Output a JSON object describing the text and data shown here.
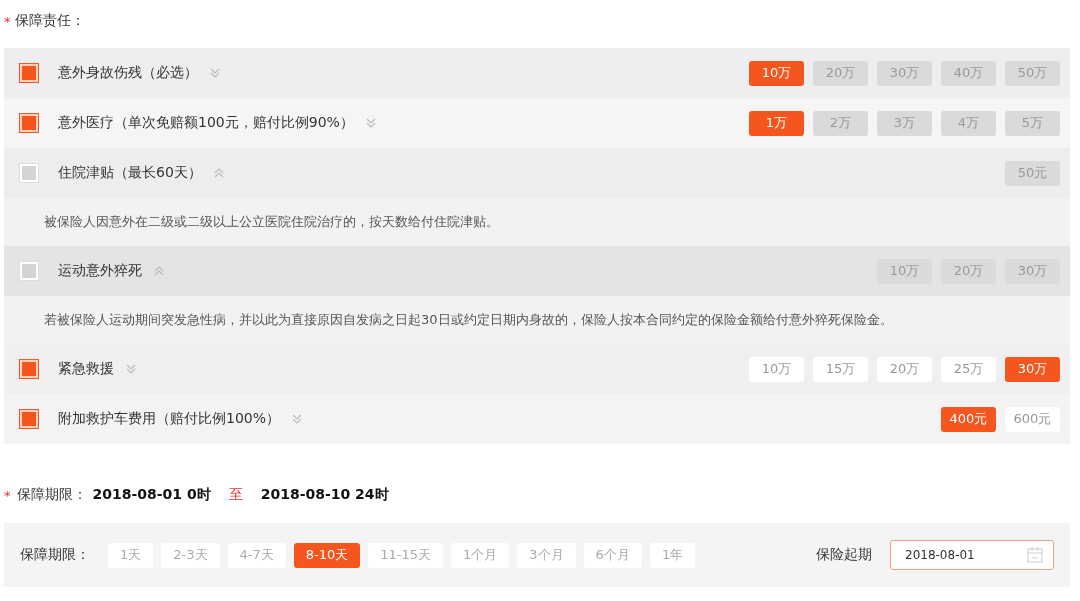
{
  "coverage": {
    "required_mark": "*",
    "label": "保障责任：",
    "items": [
      {
        "title": "意外身故伤残（必选）",
        "checked": true,
        "expanded": false,
        "options": [
          {
            "label": "10万",
            "selected": true
          },
          {
            "label": "20万",
            "selected": false
          },
          {
            "label": "30万",
            "selected": false
          },
          {
            "label": "40万",
            "selected": false
          },
          {
            "label": "50万",
            "selected": false
          }
        ]
      },
      {
        "title": "意外医疗（单次免赔额100元，赔付比例90%）",
        "checked": true,
        "expanded": false,
        "options": [
          {
            "label": "1万",
            "selected": true
          },
          {
            "label": "2万",
            "selected": false
          },
          {
            "label": "3万",
            "selected": false
          },
          {
            "label": "4万",
            "selected": false
          },
          {
            "label": "5万",
            "selected": false
          }
        ]
      },
      {
        "title": "住院津贴（最长60天）",
        "checked": false,
        "expanded": true,
        "description": "被保险人因意外在二级或二级以上公立医院住院治疗的，按天数给付住院津贴。",
        "options": [
          {
            "label": "50元",
            "selected": false
          }
        ]
      },
      {
        "title": "运动意外猝死",
        "checked": false,
        "expanded": true,
        "description": "若被保险人运动期间突发急性病，并以此为直接原因自发病之日起30日或约定日期内身故的，保险人按本合同约定的保险金额给付意外猝死保险金。",
        "options": [
          {
            "label": "10万",
            "selected": false
          },
          {
            "label": "20万",
            "selected": false
          },
          {
            "label": "30万",
            "selected": false
          }
        ]
      },
      {
        "title": "紧急救援",
        "checked": true,
        "expanded": false,
        "options": [
          {
            "label": "10万",
            "selected": false
          },
          {
            "label": "15万",
            "selected": false
          },
          {
            "label": "20万",
            "selected": false
          },
          {
            "label": "25万",
            "selected": false
          },
          {
            "label": "30万",
            "selected": true
          }
        ]
      },
      {
        "title": "附加救护车费用（赔付比例100%）",
        "checked": true,
        "expanded": false,
        "options": [
          {
            "label": "400元",
            "selected": true
          },
          {
            "label": "600元",
            "selected": false
          }
        ]
      }
    ]
  },
  "period": {
    "required_mark": "*",
    "label": "保障期限：",
    "start": "2018-08-01 0时",
    "separator": "至",
    "end": "2018-08-10 24时"
  },
  "duration": {
    "label": "保障期限：",
    "options": [
      {
        "label": "1天",
        "selected": false
      },
      {
        "label": "2-3天",
        "selected": false
      },
      {
        "label": "4-7天",
        "selected": false
      },
      {
        "label": "8-10天",
        "selected": true
      },
      {
        "label": "11-15天",
        "selected": false
      },
      {
        "label": "1个月",
        "selected": false
      },
      {
        "label": "3个月",
        "selected": false
      },
      {
        "label": "6个月",
        "selected": false
      },
      {
        "label": "1年",
        "selected": false
      }
    ],
    "start_label": "保险起期",
    "start_value": "2018-08-01"
  }
}
